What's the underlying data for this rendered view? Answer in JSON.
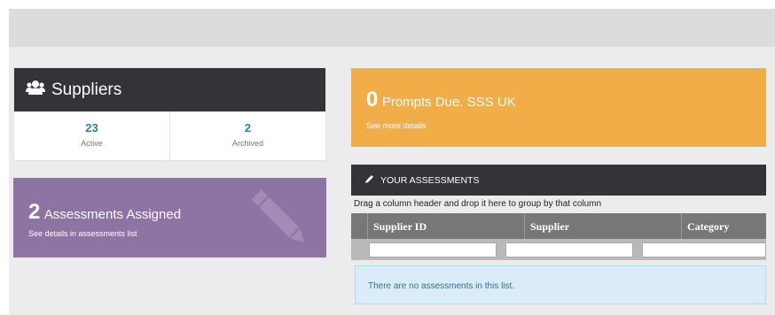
{
  "suppliers": {
    "title": "Suppliers",
    "icon": "users-icon",
    "active_count": "23",
    "active_label": "Active",
    "archived_count": "2",
    "archived_label": "Archived"
  },
  "assigned": {
    "count": "2",
    "label": "Assessments Assigned",
    "sub": "See details in assessments list",
    "icon": "pencil-icon",
    "color": "#8e73a5"
  },
  "prompts": {
    "count": "0",
    "label": "Prompts Due. SSS UK",
    "sub": "See more details",
    "color": "#f1ae48"
  },
  "assessments": {
    "title": "YOUR ASSESSMENTS",
    "icon": "pencil-icon",
    "group_hint": "Drag a column header and drop it here to group by that column",
    "columns": [
      "Supplier ID",
      "Supplier",
      "Category"
    ],
    "empty_message": "There are no assessments in this list."
  },
  "colors": {
    "dark_header": "#333338",
    "link_blue": "#2f7fb3"
  }
}
